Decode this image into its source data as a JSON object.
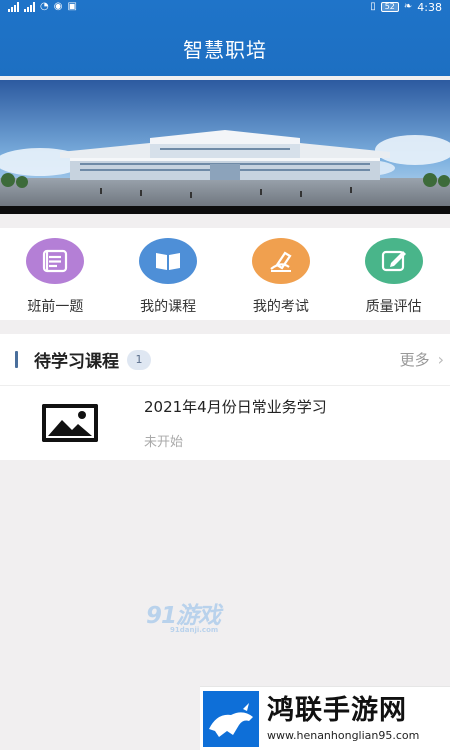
{
  "status_bar": {
    "time": "4:38",
    "battery": "52",
    "icons": [
      "signal-icon",
      "signal-icon",
      "wifi-icon",
      "eye-icon",
      "nfc-icon",
      "sim-icon",
      "battery-icon",
      "leaf-icon"
    ]
  },
  "header": {
    "title": "智慧职培"
  },
  "shortcuts": [
    {
      "label": "班前一题",
      "icon": "list-icon",
      "color": "#b47fd6"
    },
    {
      "label": "我的课程",
      "icon": "book-icon",
      "color": "#4e8fd7"
    },
    {
      "label": "我的考试",
      "icon": "pen-icon",
      "color": "#f0a04f"
    },
    {
      "label": "质量评估",
      "icon": "edit-icon",
      "color": "#49b58a"
    }
  ],
  "pending": {
    "title": "待学习课程",
    "count": "1",
    "more": "更多",
    "courses": [
      {
        "title": "2021年4月份日常业务学习",
        "status": "未开始"
      }
    ]
  },
  "watermark_91": {
    "text": "91游戏",
    "sub": "91danji.com"
  },
  "watermark_hl": {
    "text": "鸿联手游网",
    "url": "www.henanhonglian95.com"
  }
}
